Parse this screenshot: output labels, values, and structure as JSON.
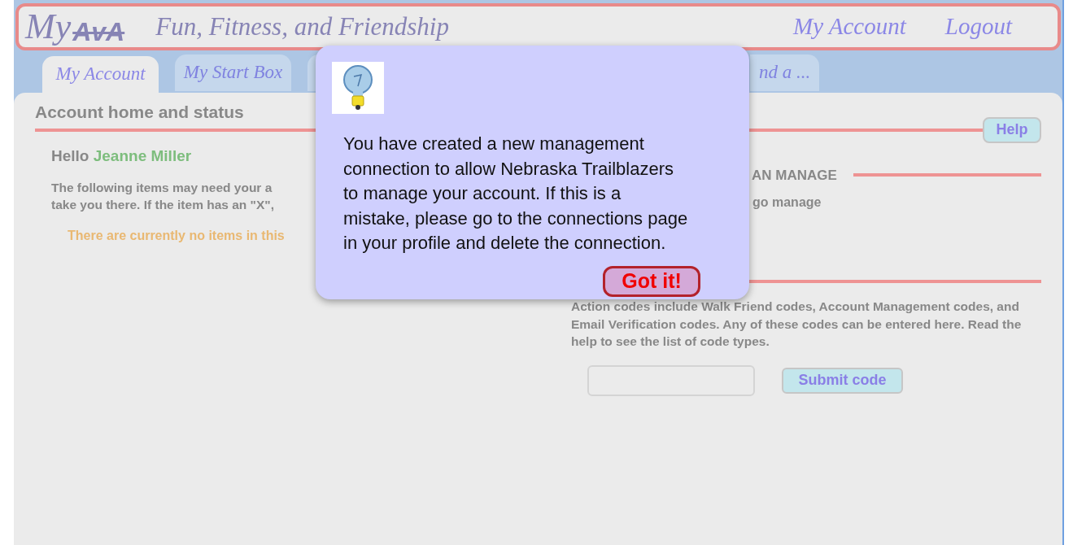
{
  "header": {
    "logo": {
      "my": "My",
      "brand": "AvA"
    },
    "tagline": "Fun, Fitness, and Friendship",
    "links": [
      {
        "label": "My Account"
      },
      {
        "label": "Logout"
      }
    ]
  },
  "tabs": [
    {
      "label": "My Account",
      "selected": true
    },
    {
      "label": "My Start Box",
      "selected": false
    },
    {
      "selected": false
    },
    {
      "label": "nd a ...",
      "selected": false
    }
  ],
  "main": {
    "title": "Account home and status",
    "help": "Help",
    "greeting": {
      "hello": "Hello",
      "name": "Jeanne Miller"
    },
    "notice_lines": [
      "The following items may need your a",
      "take you there. If the item has an \"X\","
    ],
    "empty_message": "There are currently no items in this",
    "manage_heading": "AN MANAGE",
    "manage_text": "go manage",
    "action_text": "Action codes include Walk Friend codes, Account Management codes, and Email Verification codes. Any of these codes can be entered here. Read the help to see the list of code types.",
    "submit": "Submit code"
  },
  "popup": {
    "message_lines": [
      "You have created a new management",
      "connection to allow Nebraska Trailblazers",
      "to manage your account. If this is a",
      "mistake, please go to the connections page",
      "in your profile and delete the connection."
    ],
    "button": "Got it!"
  }
}
